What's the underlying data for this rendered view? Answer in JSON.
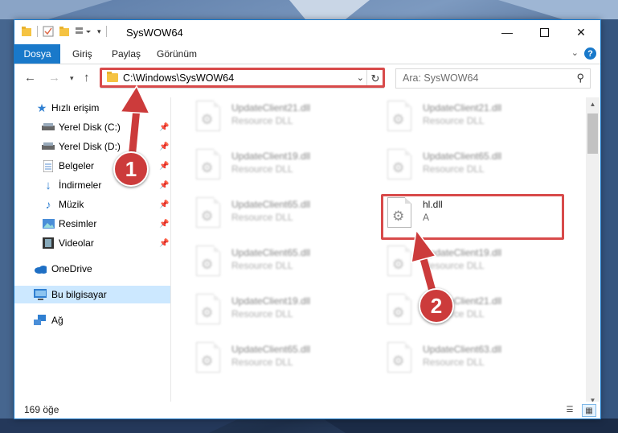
{
  "window": {
    "title": "SysWOW64",
    "minimize_icon": "minimize-icon",
    "maximize_icon": "maximize-icon",
    "close_icon": "close-icon"
  },
  "ribbon": {
    "tabs": [
      {
        "label": "Dosya",
        "active": true
      },
      {
        "label": "Giriş"
      },
      {
        "label": "Paylaş"
      },
      {
        "label": "Görünüm"
      }
    ],
    "help_label": "?"
  },
  "address": {
    "path": "C:\\Windows\\SysWOW64",
    "search_placeholder": "Ara: SysWOW64"
  },
  "sidebar": {
    "items": [
      {
        "label": "Hızlı erişim",
        "icon": "star-icon"
      },
      {
        "label": "Yerel Disk (C:)",
        "icon": "drive-icon",
        "pinned": true
      },
      {
        "label": "Yerel Disk (D:)",
        "icon": "drive-icon",
        "pinned": true
      },
      {
        "label": "Belgeler",
        "icon": "documents-icon",
        "pinned": true
      },
      {
        "label": "İndirmeler",
        "icon": "downloads-icon",
        "pinned": true
      },
      {
        "label": "Müzik",
        "icon": "music-icon",
        "pinned": true
      },
      {
        "label": "Resimler",
        "icon": "pictures-icon",
        "pinned": true
      },
      {
        "label": "Videolar",
        "icon": "videos-icon",
        "pinned": true
      },
      {
        "label": "OneDrive",
        "icon": "onedrive-icon"
      },
      {
        "label": "Bu bilgisayar",
        "icon": "computer-icon",
        "selected": true
      },
      {
        "label": "Ağ",
        "icon": "network-icon"
      }
    ]
  },
  "files": [
    {
      "name": "UpdateClient21.dll",
      "type": "Resource DLL"
    },
    {
      "name": "UpdateClient21.dll",
      "type": "Resource DLL"
    },
    {
      "name": "UpdateClient19.dll",
      "type": "Resource DLL"
    },
    {
      "name": "UpdateClient65.dll",
      "type": "Resource DLL"
    },
    {
      "name": "UpdateClient65.dll",
      "type": "Resource DLL"
    },
    {
      "name": "hl.dll",
      "type": "A",
      "highlighted": true
    },
    {
      "name": "UpdateClient65.dll",
      "type": "Resource DLL"
    },
    {
      "name": "UpdateClient19.dll",
      "type": "Resource DLL"
    },
    {
      "name": "UpdateClient19.dll",
      "type": "Resource DLL"
    },
    {
      "name": "UpdateClient21.dll",
      "type": "Resource DLL"
    },
    {
      "name": "UpdateClient65.dll",
      "type": "Resource DLL"
    },
    {
      "name": "UpdateClient63.dll",
      "type": "Resource DLL"
    }
  ],
  "status": {
    "item_count": "169 öğe"
  },
  "callouts": {
    "step1": "1",
    "step2": "2"
  },
  "colors": {
    "accent": "#1979ca",
    "highlight_border": "#d84a4a",
    "callout": "#cc3b3b",
    "selected_nav": "#cce8ff"
  }
}
